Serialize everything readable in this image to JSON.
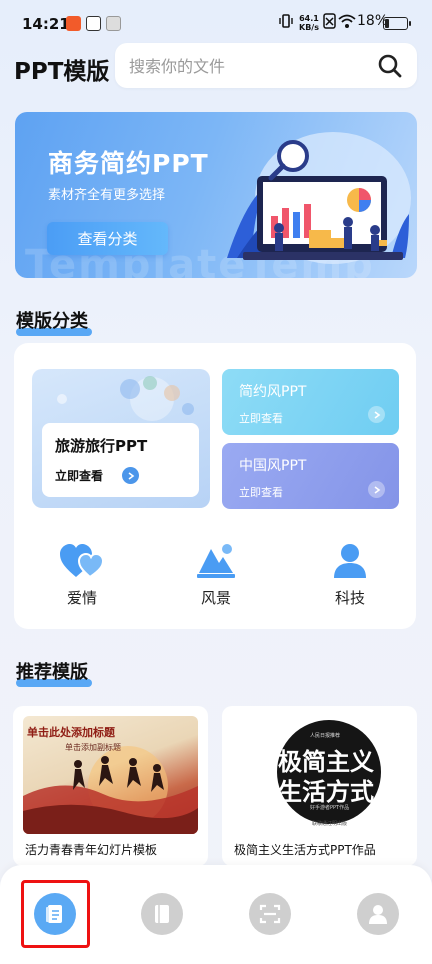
{
  "status_bar": {
    "time": "14:21",
    "speed_value": "64.1",
    "speed_unit": "KB/s",
    "battery": "18%",
    "battery_level": 0.18
  },
  "header": {
    "title": "PPT模版",
    "search_placeholder": "搜索你的文件"
  },
  "banner": {
    "title": "商务简约PPT",
    "subtitle": "素材齐全有更多选择",
    "button": "查看分类",
    "watermark": "TemplateTemp"
  },
  "categories": {
    "section_title": "模版分类",
    "featured": {
      "title": "旅游旅行PPT",
      "link": "立即查看"
    },
    "cards": [
      {
        "title": "简约风PPT",
        "link": "立即查看",
        "color": "#7dd3f5"
      },
      {
        "title": "中国风PPT",
        "link": "立即查看",
        "color": "#8da0ee"
      }
    ],
    "icons": [
      {
        "label": "爱情",
        "icon": "hearts-icon"
      },
      {
        "label": "风景",
        "icon": "landscape-icon"
      },
      {
        "label": "科技",
        "icon": "person-icon"
      }
    ]
  },
  "recommend": {
    "section_title": "推荐模版",
    "items": [
      {
        "name": "活力青春青年幻灯片模板",
        "thumb_title": "单击此处添加标题",
        "thumb_sub": "单击添加副标题"
      },
      {
        "name": "极简主义生活方式PPT作品",
        "thumb_line1": "极简主义",
        "thumb_line2": "生活方式",
        "thumb_top": "人民日报推荐",
        "thumb_caption": "好手游者PPT作品",
        "thumb_foot": "联歌通汪明出版"
      }
    ]
  },
  "bottom_nav": {
    "items": [
      "templates-icon",
      "book-icon",
      "scan-icon",
      "user-icon"
    ],
    "active": 0
  },
  "colors": {
    "accent": "#4a9cf3",
    "highlight_border": "#e11111"
  }
}
